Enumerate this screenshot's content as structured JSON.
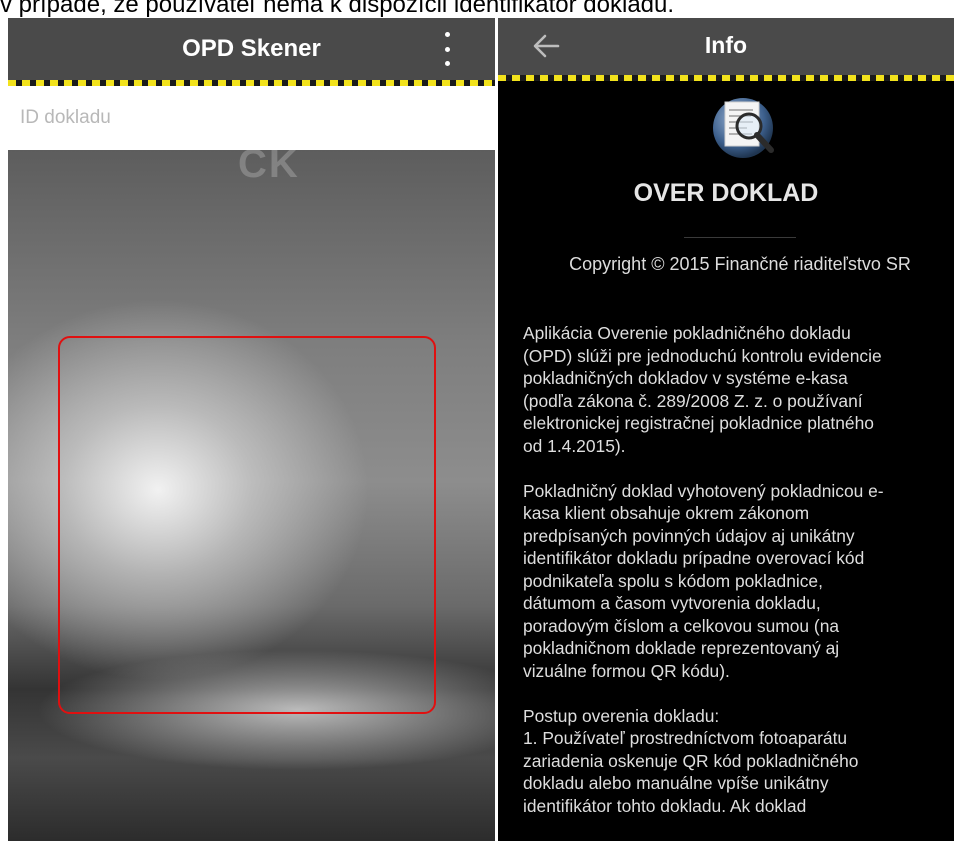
{
  "caption": "v prípade, že používateľ nemá k dispozícii identifikátor dokladu.",
  "left_screen": {
    "title": "OPD Skener",
    "menu_icon": "more-vert-icon",
    "id_field": {
      "placeholder": "ID dokladu",
      "value": ""
    },
    "camera_ghost_text": "CK"
  },
  "right_screen": {
    "title": "Info",
    "back_icon": "arrow-back-icon",
    "app_logo_icon": "receipt-magnifier-icon",
    "app_name": "OVER DOKLAD",
    "copyright": "Copyright © 2015 Finančné riaditeľstvo SR",
    "paragraphs": [
      [
        "Aplikácia Overenie pokladničného dokladu",
        "(OPD) slúži pre jednoduchú kontrolu evidencie",
        "pokladničných dokladov v systéme e-kasa",
        "(podľa zákona č. 289/2008 Z. z. o používaní",
        "elektronickej registračnej pokladnice platného",
        "od 1.4.2015)."
      ],
      [
        "Pokladničný doklad vyhotovený pokladnicou e-",
        "kasa klient obsahuje okrem zákonom",
        "predpísaných povinných údajov aj unikátny",
        "identifikátor dokladu prípadne overovací kód",
        "podnikateľa spolu s kódom pokladnice,",
        "dátumom a časom vytvorenia dokladu,",
        "poradovým číslom a celkovou sumou (na",
        "pokladničnom doklade reprezentovaný aj",
        "vizuálne formou QR kódu)."
      ],
      [
        "Postup overenia dokladu:",
        "1. Používateľ prostredníctvom fotoaparátu",
        "zariadenia oskenuje QR kód pokladničného",
        "dokladu alebo manuálne vpíše unikátny",
        "identifikátor tohto dokladu. Ak doklad"
      ]
    ]
  },
  "colors": {
    "appbar": "#4a4a4a",
    "hazard_yellow": "#f2e21c",
    "scan_frame": "#e01010",
    "info_background": "#000000"
  }
}
